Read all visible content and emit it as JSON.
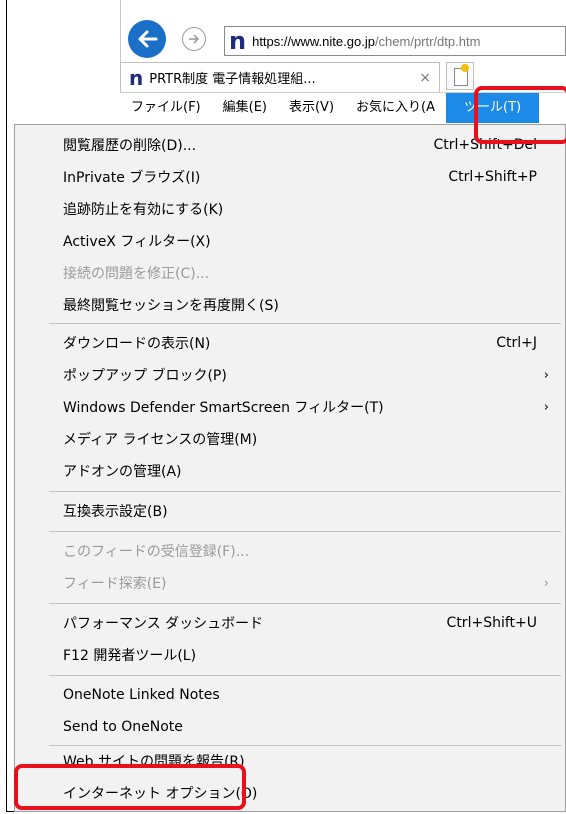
{
  "browser": {
    "url_domain": "https://www.nite.go.jp",
    "url_path": "/chem/prtr/dtp.htm",
    "site_icon": "n",
    "tab_title": "PRTR制度 電子情報処理組...",
    "tab_close": "×"
  },
  "menubar": {
    "items": [
      "ファイル(F)",
      "編集(E)",
      "表示(V)",
      "お気に入り(A",
      "ツール(T)"
    ]
  },
  "tools_menu": {
    "items": [
      {
        "label": "閲覧履歴の削除(D)...",
        "shortcut": "Ctrl+Shift+Del"
      },
      {
        "label": "InPrivate ブラウズ(I)",
        "shortcut": "Ctrl+Shift+P"
      },
      {
        "label": "追跡防止を有効にする(K)",
        "shortcut": ""
      },
      {
        "label": "ActiveX フィルター(X)",
        "shortcut": ""
      },
      {
        "label": "接続の問題を修正(C)...",
        "shortcut": "",
        "disabled": true
      },
      {
        "label": "最終閲覧セッションを再度開く(S)",
        "shortcut": ""
      },
      {
        "label": "ダウンロードの表示(N)",
        "shortcut": "Ctrl+J"
      },
      {
        "label": "ポップアップ ブロック(P)",
        "shortcut": "",
        "submenu": true
      },
      {
        "label": "Windows Defender SmartScreen フィルター(T)",
        "shortcut": "",
        "submenu": true
      },
      {
        "label": "メディア ライセンスの管理(M)",
        "shortcut": ""
      },
      {
        "label": "アドオンの管理(A)",
        "shortcut": ""
      },
      {
        "label": "互換表示設定(B)",
        "shortcut": ""
      },
      {
        "label": "このフィードの受信登録(F)...",
        "shortcut": "",
        "disabled": true
      },
      {
        "label": "フィード探索(E)",
        "shortcut": "",
        "disabled": true,
        "submenu": true
      },
      {
        "label": "パフォーマンス ダッシュボード",
        "shortcut": "Ctrl+Shift+U"
      },
      {
        "label": "F12 開発者ツール(L)",
        "shortcut": ""
      },
      {
        "label": "OneNote Linked Notes",
        "shortcut": ""
      },
      {
        "label": "Send to OneNote",
        "shortcut": ""
      },
      {
        "label": "Web サイトの問題を報告(R)",
        "shortcut": ""
      },
      {
        "label": "インターネット オプション(O)",
        "shortcut": ""
      }
    ],
    "submenu_arrow": "›"
  },
  "colors": {
    "highlight_box": "#e8101c",
    "menubar_active": "#1c8be8",
    "back_button": "#1a6fc9"
  }
}
